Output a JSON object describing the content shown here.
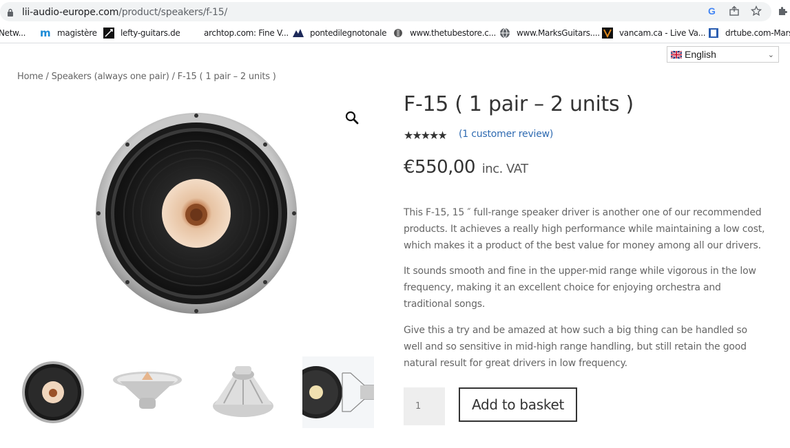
{
  "browser": {
    "url_domain": "lii-audio-europe.com",
    "url_path": "/product/speakers/f-15/",
    "bookmarks": [
      {
        "label": "Netw...",
        "icon": "network-icon"
      },
      {
        "label": "magistère",
        "icon": "m-logo-icon"
      },
      {
        "label": "lefty-guitars.de",
        "icon": "lefty-guitars-icon"
      },
      {
        "label": "archtop.com: Fine V...",
        "icon": "blank-icon"
      },
      {
        "label": "pontedilegnotonale",
        "icon": "mountain-icon"
      },
      {
        "label": "www.thetubestore.c...",
        "icon": "tubestore-icon"
      },
      {
        "label": "www.MarksGuitars....",
        "icon": "globe-icon"
      },
      {
        "label": "vancam.ca - Live Va...",
        "icon": "vancam-v-icon"
      },
      {
        "label": "drtube.com-Marsh",
        "icon": "drtube-icon"
      }
    ]
  },
  "language": {
    "selected": "English"
  },
  "breadcrumb": "Home / Speakers (always one pair) / F-15 ( 1 pair – 2 units )",
  "product": {
    "title": "F-15 ( 1 pair – 2 units )",
    "rating": 5,
    "rating_stars": "★★★★★",
    "review_link": "(1 customer review)",
    "price": "€550,00",
    "price_suffix": "inc. VAT",
    "description": [
      "This F-15, 15 ″ full-range speaker driver is another one of our recommended products. It achieves a really high performance while maintaining a low cost, which makes it a product of the best value for money among all our drivers.",
      "It sounds smooth and fine in the upper-mid range while vigorous in the low frequency, making it an excellent choice for enjoying orchestra and traditional songs.",
      "Give this a try and be amazed at how such a big thing can be handled so well and so sensitive in mid-high range handling, but still retain the good natural result for great drivers in low frequency."
    ],
    "quantity": "1",
    "add_to_basket": "Add to basket"
  }
}
